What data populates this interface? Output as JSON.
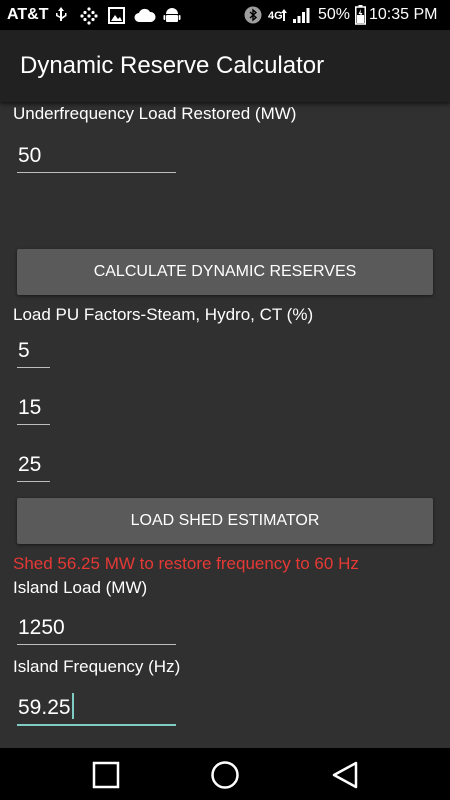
{
  "status_bar": {
    "carrier": "AT&T",
    "battery_percent": "50%",
    "time": "10:35 PM",
    "left_icons": [
      "usb-icon",
      "dots-grid-icon",
      "image-icon",
      "cloud-icon",
      "android-icon"
    ],
    "right_icons": [
      "bluetooth-icon",
      "lte-icon",
      "signal-icon",
      "battery-icon"
    ]
  },
  "app_bar": {
    "title": "Dynamic Reserve Calculator"
  },
  "form": {
    "uf_load_restored_label": "Underfrequency Load Restored (MW)",
    "uf_load_restored_value": "50",
    "calc_button_label": "CALCULATE DYNAMIC RESERVES",
    "pu_factors_label": "Load PU Factors-Steam, Hydro, CT (%)",
    "pu_steam_value": "5",
    "pu_hydro_value": "15",
    "pu_ct_value": "25",
    "load_shed_button_label": "LOAD SHED ESTIMATOR",
    "result_text": "Shed 56.25 MW to restore frequency to 60 Hz",
    "island_load_label": "Island Load (MW)",
    "island_load_value": "1250",
    "island_freq_label": "Island Frequency (Hz)",
    "island_freq_value": "59.25"
  },
  "colors": {
    "background": "#303030",
    "app_bar": "#212121",
    "button": "#5a5a5a",
    "error_text": "#e53935",
    "focus_accent": "#80cbc4"
  },
  "nav_bar": {
    "buttons": [
      "recents-square-icon",
      "home-circle-icon",
      "back-triangle-icon"
    ]
  }
}
